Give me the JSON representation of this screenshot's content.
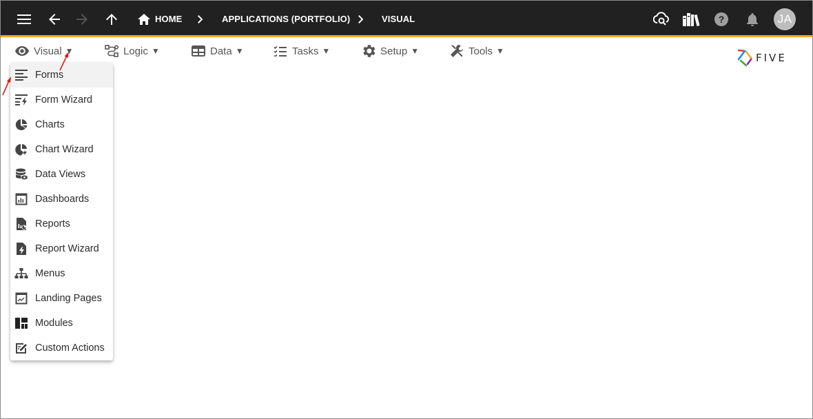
{
  "breadcrumb": {
    "home": "HOME",
    "applications": "APPLICATIONS (PORTFOLIO)",
    "visual": "VISUAL"
  },
  "user": {
    "initials": "JA"
  },
  "menubar": {
    "visual": "Visual",
    "logic": "Logic",
    "data": "Data",
    "tasks": "Tasks",
    "setup": "Setup",
    "tools": "Tools",
    "caret": "▼"
  },
  "logo": {
    "text": "FIVE"
  },
  "dropdown": {
    "items": [
      {
        "label": "Forms",
        "icon": "forms-icon"
      },
      {
        "label": "Form Wizard",
        "icon": "form-wizard-icon"
      },
      {
        "label": "Charts",
        "icon": "charts-icon"
      },
      {
        "label": "Chart Wizard",
        "icon": "chart-wizard-icon"
      },
      {
        "label": "Data Views",
        "icon": "data-views-icon"
      },
      {
        "label": "Dashboards",
        "icon": "dashboards-icon"
      },
      {
        "label": "Reports",
        "icon": "reports-icon"
      },
      {
        "label": "Report Wizard",
        "icon": "report-wizard-icon"
      },
      {
        "label": "Menus",
        "icon": "menus-icon"
      },
      {
        "label": "Landing Pages",
        "icon": "landing-pages-icon"
      },
      {
        "label": "Modules",
        "icon": "modules-icon"
      },
      {
        "label": "Custom Actions",
        "icon": "custom-actions-icon"
      }
    ]
  },
  "colors": {
    "appbar": "#212121",
    "accent": "#f6a623",
    "annotation_arrow": "#e01818"
  }
}
